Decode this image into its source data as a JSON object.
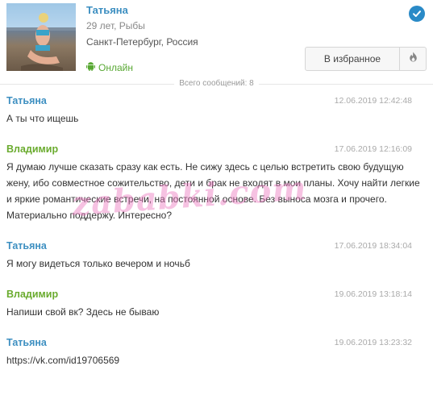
{
  "profile": {
    "name": "Татьяна",
    "age_sign": "29 лет, Рыбы",
    "location": "Санкт-Петербург, Россия",
    "status": "Онлайн",
    "favorite_label": "В избранное"
  },
  "conversation": {
    "total_label": "Всего сообщений: 8",
    "messages": [
      {
        "author": "Татьяна",
        "date": "12.06.2019 12:42:48",
        "text": "А ты что ищешь"
      },
      {
        "author": "Владимир",
        "date": "17.06.2019 12:16:09",
        "text": "Я думаю лучше сказать сразу как есть. Не сижу здесь с целью встретить свою будущую жену, ибо совместное сожительство, дети и брак не входят в мои планы. Хочу найти легкие и яркие романтические встречи, на постоянной основе. Без выноса мозга и прочего. Материально поддержу. Интересно?"
      },
      {
        "author": "Татьяна",
        "date": "17.06.2019 18:34:04",
        "text": "Я могу видеться только вечером и ночьб"
      },
      {
        "author": "Владимир",
        "date": "19.06.2019 13:18:14",
        "text": "Напиши свой вк? Здесь не бываю"
      },
      {
        "author": "Татьяна",
        "date": "19.06.2019 13:23:32",
        "text": "https://vk.com/id19706569"
      }
    ]
  },
  "watermark": "zababki.com",
  "colors": {
    "female_name": "#3d8fc1",
    "male_name": "#6aab2e",
    "online": "#58a833",
    "verified": "#2a8ac7",
    "watermark": "#ec78be"
  },
  "icons": [
    "verified-check-icon",
    "android-icon",
    "fire-icon"
  ]
}
